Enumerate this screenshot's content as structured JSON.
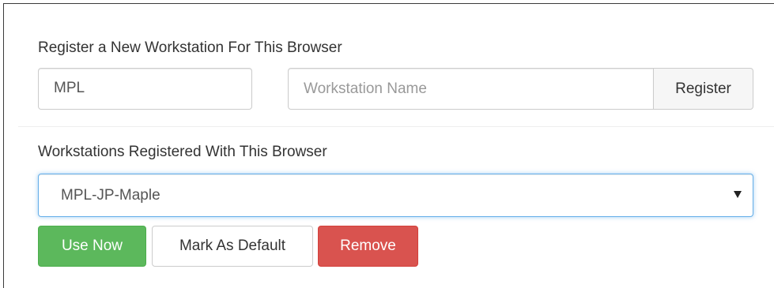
{
  "register_section": {
    "label": "Register a New Workstation For This Browser",
    "prefix_value": "MPL",
    "name_placeholder": "Workstation Name",
    "name_value": "",
    "register_label": "Register"
  },
  "registered_section": {
    "label": "Workstations Registered With This Browser",
    "selected_workstation": "MPL-JP-Maple"
  },
  "actions": {
    "use_now_label": "Use Now",
    "mark_default_label": "Mark As Default",
    "remove_label": "Remove"
  },
  "colors": {
    "success": "#5cb85c",
    "danger": "#d9534f",
    "focus_border": "#66afe9"
  }
}
